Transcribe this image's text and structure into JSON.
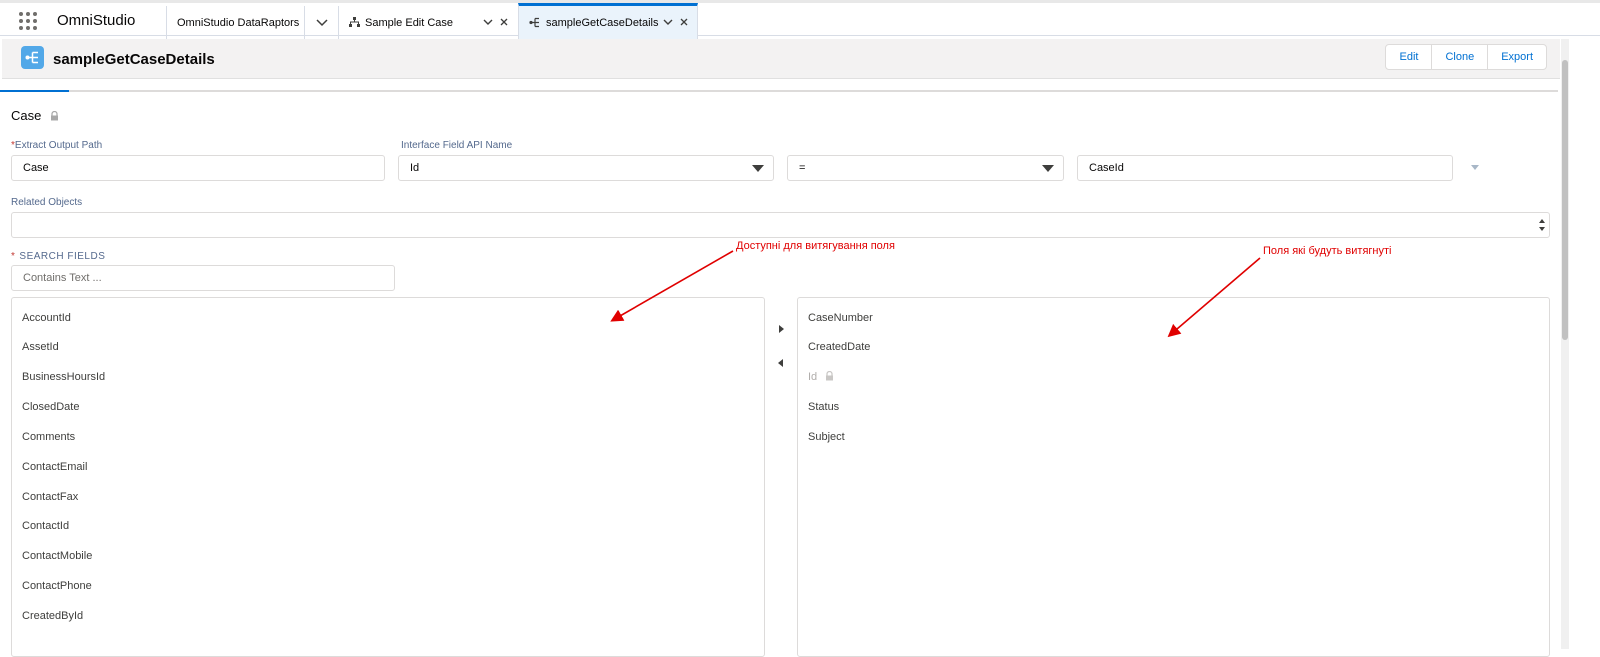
{
  "app": {
    "name": "OmniStudio"
  },
  "tabs": [
    {
      "label": "OmniStudio DataRaptors"
    },
    {
      "label": "Sample Edit Case"
    },
    {
      "label": "sampleGetCaseDetails"
    }
  ],
  "header": {
    "title": "sampleGetCaseDetails",
    "buttons": {
      "edit": "Edit",
      "clone": "Clone",
      "export": "Export"
    }
  },
  "form": {
    "object_label": "Case",
    "extract_output_path": {
      "label": "Extract Output Path",
      "required_mark": "*",
      "value": "Case"
    },
    "interface_field": {
      "label": "Interface Field API Name",
      "value": "Id"
    },
    "operator": {
      "value": "="
    },
    "filter_value": {
      "value": "CaseId"
    },
    "related_objects": {
      "label": "Related Objects",
      "value": ""
    },
    "search_fields": {
      "label": "SEARCH FIELDS",
      "required_mark": "*",
      "placeholder": "Contains Text ..."
    }
  },
  "available_fields": [
    "AccountId",
    "AssetId",
    "BusinessHoursId",
    "ClosedDate",
    "Comments",
    "ContactEmail",
    "ContactFax",
    "ContactId",
    "ContactMobile",
    "ContactPhone",
    "CreatedById"
  ],
  "selected_fields": [
    {
      "label": "CaseNumber",
      "locked": false
    },
    {
      "label": "CreatedDate",
      "locked": false
    },
    {
      "label": "Id",
      "locked": true
    },
    {
      "label": "Status",
      "locked": false
    },
    {
      "label": "Subject",
      "locked": false
    }
  ],
  "annotations": {
    "available": "Доступні для витягування поля",
    "selected": "Поля які будуть витягнуті"
  },
  "colors": {
    "accent": "#0070d2",
    "annotation": "#e00000",
    "object_icon": "#52a8e8"
  },
  "icons": {
    "app_launcher": "waffle-icon",
    "object": "dataraptor-icon",
    "lock": "lock-icon",
    "move_right": "arrow-right-icon",
    "move_left": "arrow-left-icon"
  }
}
